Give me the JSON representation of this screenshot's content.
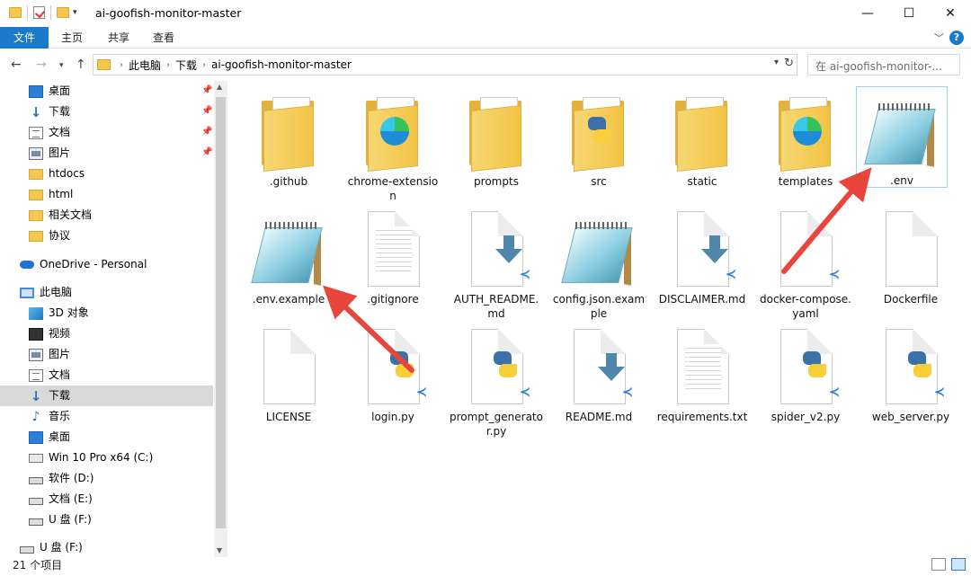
{
  "window": {
    "title": "ai-goofish-monitor-master",
    "minimize": "—",
    "maximize": "☐",
    "close": "✕"
  },
  "ribbon": {
    "tabs": [
      "文件",
      "主页",
      "共享",
      "查看"
    ],
    "help": "?"
  },
  "address": {
    "crumbs": [
      "此电脑",
      "下载",
      "ai-goofish-monitor-master"
    ],
    "search_placeholder": "在 ai-goofish-monitor-..."
  },
  "sidebar": {
    "items": [
      {
        "label": "桌面",
        "icon": "desktop-icon",
        "pinned": true
      },
      {
        "label": "下载",
        "icon": "download-icon",
        "pinned": true
      },
      {
        "label": "文档",
        "icon": "document-icon",
        "pinned": true
      },
      {
        "label": "图片",
        "icon": "picture-icon",
        "pinned": true
      },
      {
        "label": "htdocs",
        "icon": "folder-icon"
      },
      {
        "label": "html",
        "icon": "folder-icon"
      },
      {
        "label": "相关文档",
        "icon": "folder-icon"
      },
      {
        "label": "协议",
        "icon": "folder-icon"
      },
      {
        "label": "OneDrive - Personal",
        "icon": "cloud-icon"
      },
      {
        "label": "此电脑",
        "icon": "computer-icon"
      },
      {
        "label": "3D 对象",
        "icon": "3d-objects-icon"
      },
      {
        "label": "视频",
        "icon": "video-icon"
      },
      {
        "label": "图片",
        "icon": "picture-icon"
      },
      {
        "label": "文档",
        "icon": "document-icon"
      },
      {
        "label": "下载",
        "icon": "download-icon",
        "selected": true
      },
      {
        "label": "音乐",
        "icon": "music-icon"
      },
      {
        "label": "桌面",
        "icon": "desktop-icon"
      },
      {
        "label": "Win 10 Pro x64 (C:)",
        "icon": "windows-drive-icon"
      },
      {
        "label": "软件 (D:)",
        "icon": "drive-icon"
      },
      {
        "label": "文档 (E:)",
        "icon": "drive-icon"
      },
      {
        "label": "U 盘 (F:)",
        "icon": "drive-icon"
      },
      {
        "label": "U 盘 (F:)",
        "icon": "drive-icon"
      }
    ]
  },
  "files": [
    {
      "name": ".github",
      "kind": "folder"
    },
    {
      "name": "chrome-extension",
      "kind": "folder-edge"
    },
    {
      "name": "prompts",
      "kind": "folder"
    },
    {
      "name": "src",
      "kind": "folder-python"
    },
    {
      "name": "static",
      "kind": "folder"
    },
    {
      "name": "templates",
      "kind": "folder-edge"
    },
    {
      "name": ".env",
      "kind": "notepad",
      "selected": true
    },
    {
      "name": ".env.example",
      "kind": "notepad"
    },
    {
      "name": ".gitignore",
      "kind": "text"
    },
    {
      "name": "AUTH_README.md",
      "kind": "markdown"
    },
    {
      "name": "config.json.example",
      "kind": "notepad"
    },
    {
      "name": "DISCLAIMER.md",
      "kind": "markdown"
    },
    {
      "name": "docker-compose.yaml",
      "kind": "vscode"
    },
    {
      "name": "Dockerfile",
      "kind": "blank"
    },
    {
      "name": "LICENSE",
      "kind": "blank"
    },
    {
      "name": "login.py",
      "kind": "python"
    },
    {
      "name": "prompt_generator.py",
      "kind": "python"
    },
    {
      "name": "README.md",
      "kind": "markdown"
    },
    {
      "name": "requirements.txt",
      "kind": "text"
    },
    {
      "name": "spider_v2.py",
      "kind": "python"
    },
    {
      "name": "web_server.py",
      "kind": "python"
    }
  ],
  "status": {
    "count": "21 个项目"
  },
  "colors": {
    "accent": "#1979ca",
    "annotation_arrow": "#e8453c",
    "selection_border": "#99d1ff"
  }
}
